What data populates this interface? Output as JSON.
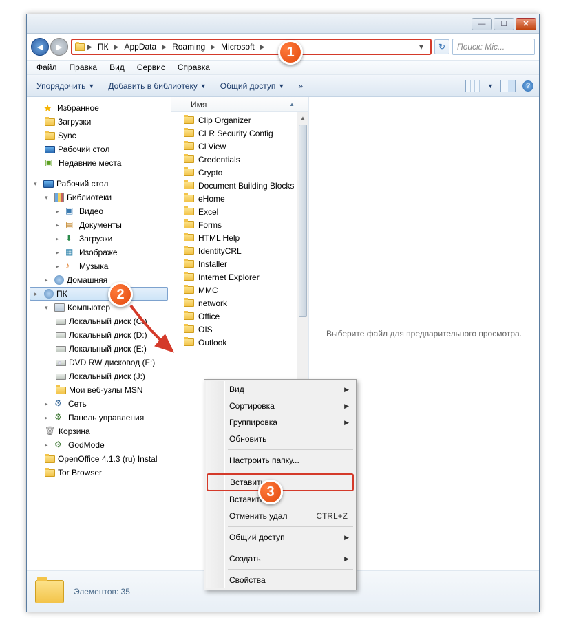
{
  "breadcrumb": [
    "ПК",
    "AppData",
    "Roaming",
    "Microsoft"
  ],
  "search_placeholder": "Поиск: Mic...",
  "menubar": [
    "Файл",
    "Правка",
    "Вид",
    "Сервис",
    "Справка"
  ],
  "toolbar": {
    "organize": "Упорядочить",
    "addlib": "Добавить в библиотеку",
    "share": "Общий доступ"
  },
  "sidebar": {
    "fav": "Избранное",
    "fav_items": [
      "Загрузки",
      "Sync",
      "Рабочий стол",
      "Недавние места"
    ],
    "desktop": "Рабочий стол",
    "libs": "Библиотеки",
    "lib_items": [
      "Видео",
      "Документы",
      "Загрузки",
      "Изображе",
      "Музыка"
    ],
    "homegroup": "Домашняя",
    "pk": "ПК",
    "computer": "Компьютер",
    "drives": [
      "Локальный диск (C:)",
      "Локальный диск (D:)",
      "Локальный диск (E:)",
      "DVD RW дисковод (F:)",
      "Локальный диск (J:)",
      "Мои веб-узлы MSN"
    ],
    "network": "Сеть",
    "cpanel": "Панель управления",
    "recycle": "Корзина",
    "godmode": "GodMode",
    "oo": "OpenOffice 4.1.3 (ru) Instal",
    "tor": "Tor Browser"
  },
  "col_name": "Имя",
  "files": [
    "Clip Organizer",
    "CLR Security Config",
    "CLView",
    "Credentials",
    "Crypto",
    "Document Building Blocks",
    "eHome",
    "Excel",
    "Forms",
    "HTML Help",
    "IdentityCRL",
    "Installer",
    "Internet Explorer",
    "MMC",
    "network",
    "Office",
    "OIS",
    "Outlook"
  ],
  "preview_text": "Выберите файл для предварительного просмотра.",
  "status_text": "Элементов: 35",
  "ctx": {
    "view": "Вид",
    "sort": "Сортировка",
    "group": "Группировка",
    "refresh": "Обновить",
    "customize": "Настроить папку...",
    "paste": "Вставить",
    "pastesc": "Вставить ярл",
    "undo": "Отменить удал",
    "undo_sc": "CTRL+Z",
    "share": "Общий доступ",
    "new": "Создать",
    "props": "Свойства"
  },
  "badges": {
    "b1": "1",
    "b2": "2",
    "b3": "3"
  }
}
